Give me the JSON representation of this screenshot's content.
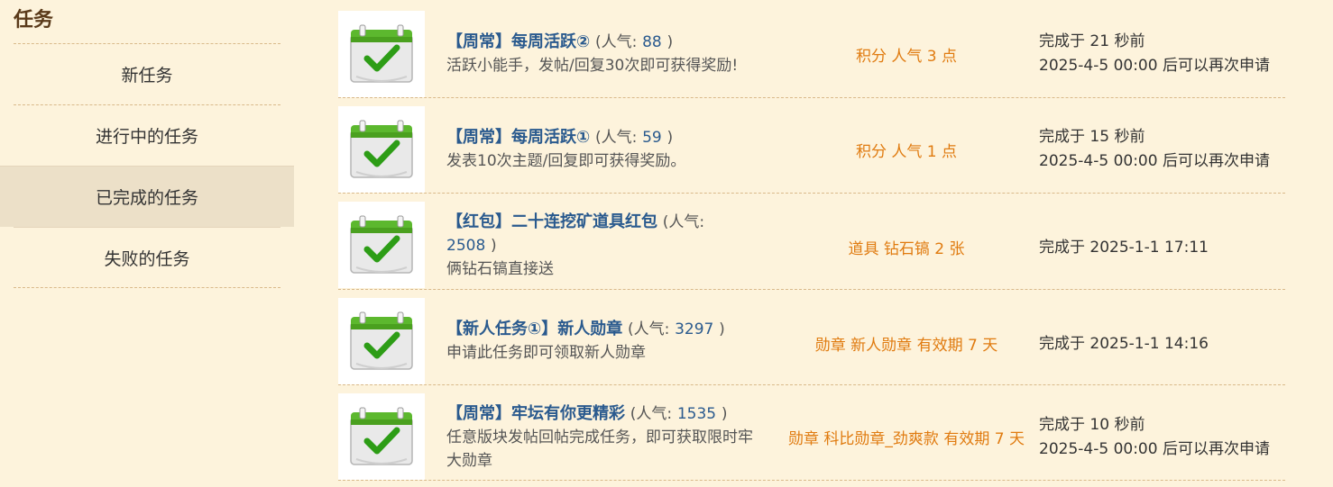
{
  "sidebar": {
    "title": "任务",
    "items": [
      {
        "label": "新任务"
      },
      {
        "label": "进行中的任务"
      },
      {
        "label": "已完成的任务"
      },
      {
        "label": "失败的任务"
      }
    ]
  },
  "tasks": [
    {
      "title": "【周常】每周活跃②",
      "pop_open": "(人气:",
      "pop_value": "88",
      "pop_close": ")",
      "desc": "活跃小能手，发帖/回复30次即可获得奖励!",
      "reward": "积分 人气 3 点",
      "status_line1": "完成于 21 秒前",
      "status_line2": "2025-4-5 00:00 后可以再次申请"
    },
    {
      "title": "【周常】每周活跃①",
      "pop_open": "(人气:",
      "pop_value": "59",
      "pop_close": ")",
      "desc": "发表10次主题/回复即可获得奖励。",
      "reward": "积分 人气 1 点",
      "status_line1": "完成于 15 秒前",
      "status_line2": "2025-4-5 00:00 后可以再次申请"
    },
    {
      "title": "【红包】二十连挖矿道具红包",
      "pop_open": "(人气:",
      "pop_value": "2508",
      "pop_close": ")",
      "desc": "俩钻石镐直接送",
      "reward": "道具 钻石镐 2 张",
      "status_line1": "完成于 2025-1-1 17:11",
      "status_line2": ""
    },
    {
      "title": "【新人任务①】新人勋章",
      "pop_open": "(人气:",
      "pop_value": "3297",
      "pop_close": ")",
      "desc": "申请此任务即可领取新人勋章",
      "reward": "勋章 新人勋章 有效期 7 天",
      "status_line1": "完成于 2025-1-1 14:16",
      "status_line2": ""
    },
    {
      "title": "【周常】牢坛有你更精彩",
      "pop_open": "(人气:",
      "pop_value": "1535",
      "pop_close": ")",
      "desc": "任意版块发帖回帖完成任务，即可获取限时牢大勋章",
      "reward": "勋章 科比勋章_劲爽款 有效期 7 天",
      "status_line1": "完成于 10 秒前",
      "status_line2": "2025-4-5 00:00 后可以再次申请"
    }
  ]
}
